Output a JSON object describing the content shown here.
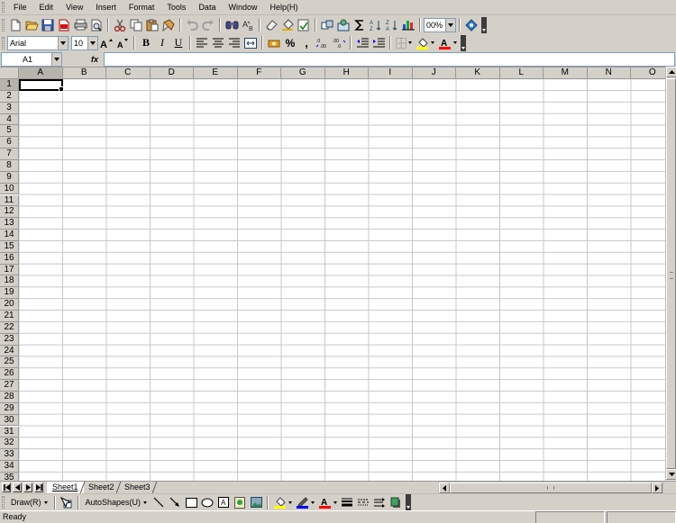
{
  "menu": {
    "items": [
      "File",
      "Edit",
      "View",
      "Insert",
      "Format",
      "Tools",
      "Data",
      "Window",
      "Help(H)"
    ]
  },
  "standard_toolbar": {
    "zoom": "00%"
  },
  "formatting_toolbar": {
    "font_name": "Arial",
    "font_size": "10",
    "bold_label": "B",
    "italic_label": "I",
    "underline_label": "U",
    "percent_label": "%",
    "comma_label": ","
  },
  "formula_bar": {
    "name_box": "A1",
    "fx_label": "fx",
    "formula": ""
  },
  "grid": {
    "columns": [
      "A",
      "B",
      "C",
      "D",
      "E",
      "F",
      "G",
      "H",
      "I",
      "J",
      "K",
      "L",
      "M",
      "N",
      "O"
    ],
    "rows": [
      "1",
      "2",
      "3",
      "4",
      "5",
      "6",
      "7",
      "8",
      "9",
      "10",
      "11",
      "12",
      "13",
      "14",
      "15",
      "16",
      "17",
      "18",
      "19",
      "20",
      "21",
      "22",
      "23",
      "24",
      "25",
      "26",
      "27",
      "28",
      "29",
      "30",
      "31",
      "32",
      "33",
      "34",
      "35"
    ],
    "active_cell": "A1"
  },
  "sheets": {
    "tabs": [
      "Sheet1",
      "Sheet2",
      "Sheet3"
    ],
    "active": "Sheet1"
  },
  "drawing_toolbar": {
    "draw_label": "Draw(R)",
    "autoshapes_label": "AutoShapes(U)"
  },
  "status": {
    "text": "Ready"
  },
  "colors": {
    "fill_swatch": "#ffff00",
    "line_swatch": "#0000ff",
    "font_swatch": "#ff0000",
    "highlight_swatch": "#ffff00"
  }
}
